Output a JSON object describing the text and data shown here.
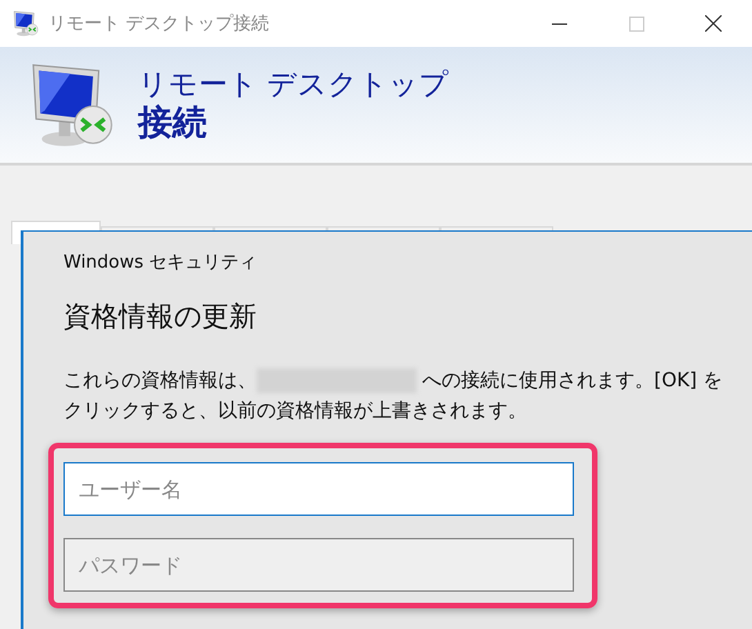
{
  "window": {
    "title": "リモート デスクトップ接続"
  },
  "header": {
    "line1": "リモート デスクトップ",
    "line2": "接続"
  },
  "tabs": [
    {
      "selected": true
    },
    {
      "selected": false
    },
    {
      "selected": false
    },
    {
      "selected": false
    },
    {
      "selected": false
    }
  ],
  "dialog": {
    "caption": "Windows セキュリティ",
    "heading": "資格情報の更新",
    "message_before": "これらの資格情報は、",
    "message_after": "への接続に使用されます。[OK] を",
    "message_line2": "クリックすると、以前の資格情報が上書きされます。"
  },
  "fields": [
    {
      "placeholder": "ユーザー名",
      "focused": true
    },
    {
      "placeholder": "パスワード",
      "focused": false
    }
  ]
}
